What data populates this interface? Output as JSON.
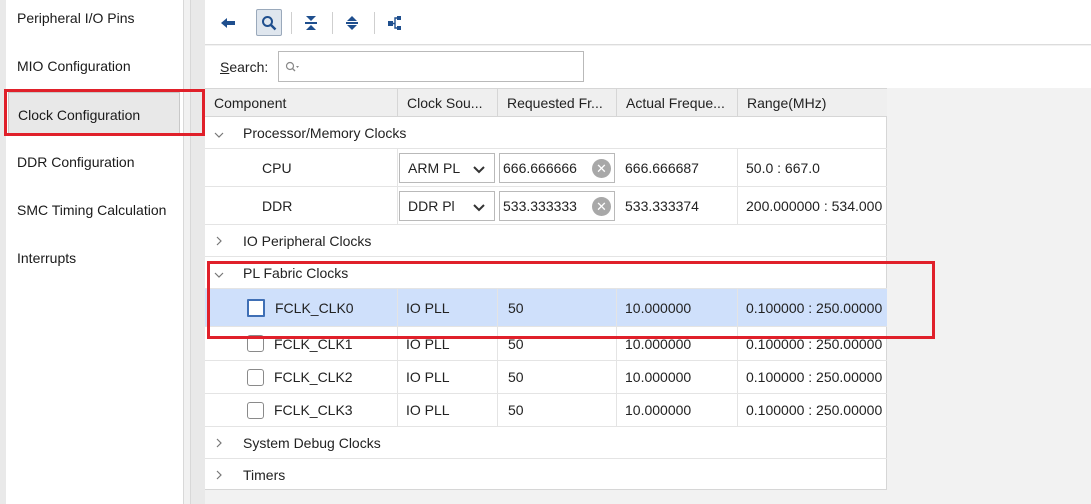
{
  "nav": {
    "items": [
      {
        "label": "Peripheral I/O Pins"
      },
      {
        "label": "MIO Configuration"
      },
      {
        "label": "Clock Configuration",
        "selected": true
      },
      {
        "label": "DDR Configuration"
      },
      {
        "label": "SMC Timing Calculation"
      },
      {
        "label": "Interrupts"
      }
    ]
  },
  "toolbar": {
    "icons": [
      "back-arrow-icon",
      "search-icon",
      "collapse-all-icon",
      "expand-all-icon",
      "hierarchy-icon"
    ]
  },
  "search": {
    "label_prefix": "S",
    "label_rest": "earch:",
    "value": "",
    "placeholder": ""
  },
  "table": {
    "columns": [
      "Component",
      "Clock Sou...",
      "Requested Fr...",
      "Actual Freque...",
      "Range(MHz)"
    ],
    "groups": {
      "processor": {
        "label": "Processor/Memory Clocks",
        "expanded": true
      },
      "io": {
        "label": "IO Peripheral Clocks",
        "expanded": false
      },
      "pl": {
        "label": "PL Fabric Clocks",
        "expanded": true
      },
      "debug": {
        "label": "System Debug Clocks",
        "expanded": false
      },
      "timers": {
        "label": "Timers",
        "expanded": false
      }
    },
    "processor_rows": [
      {
        "component": "CPU",
        "source": "ARM PL",
        "requested": "666.666666",
        "actual": "666.666687",
        "range": "50.0 : 667.0"
      },
      {
        "component": "DDR",
        "source": "DDR Pl",
        "requested": "533.333333",
        "actual": "533.333374",
        "range": "200.000000 : 534.000"
      }
    ],
    "pl_rows": [
      {
        "component": "FCLK_CLK0",
        "source": "IO PLL",
        "requested": "50",
        "actual": "10.000000",
        "range": "0.100000 : 250.00000",
        "checked": false
      },
      {
        "component": "FCLK_CLK1",
        "source": "IO PLL",
        "requested": "50",
        "actual": "10.000000",
        "range": "0.100000 : 250.00000",
        "checked": false
      },
      {
        "component": "FCLK_CLK2",
        "source": "IO PLL",
        "requested": "50",
        "actual": "10.000000",
        "range": "0.100000 : 250.00000",
        "checked": false
      },
      {
        "component": "FCLK_CLK3",
        "source": "IO PLL",
        "requested": "50",
        "actual": "10.000000",
        "range": "0.100000 : 250.00000",
        "checked": false
      }
    ]
  },
  "colors": {
    "highlight": "#e0202a",
    "selection": "#cfe0fb",
    "accent": "#2a5a9a"
  }
}
